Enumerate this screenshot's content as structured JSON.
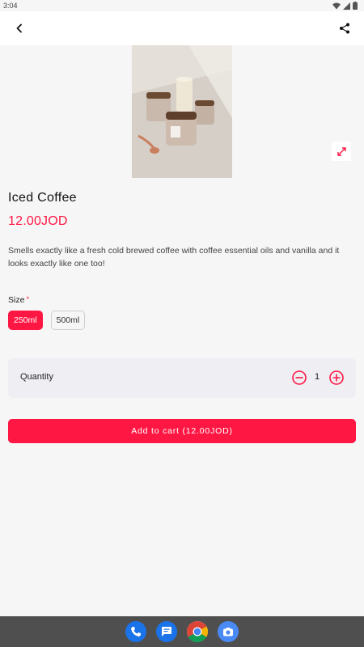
{
  "status_bar": {
    "time": "3:04",
    "icons": [
      "wifi-icon",
      "signal-icon",
      "battery-icon"
    ]
  },
  "app_bar": {
    "back_icon": "back-arrow-icon",
    "share_icon": "share-icon"
  },
  "product": {
    "image_icon": "product-photo",
    "expand_icon": "expand-icon",
    "title": "Iced Coffee",
    "price": "12.00JOD",
    "description": "Smells exactly like a fresh cold brewed coffee with coffee essential oils and vanilla and it looks exactly like one too!"
  },
  "size": {
    "label": "Size",
    "required_marker": "*",
    "options": [
      {
        "label": "250ml",
        "selected": true
      },
      {
        "label": "500ml",
        "selected": false
      }
    ]
  },
  "quantity": {
    "label": "Quantity",
    "value": "1",
    "minus_icon": "minus-circle-icon",
    "plus_icon": "plus-circle-icon"
  },
  "cart_button": {
    "label": "Add to cart (12.00JOD)"
  },
  "colors": {
    "accent": "#ff1744",
    "background": "#f6f6f6",
    "card": "#efeef3",
    "nav_bar": "#4f4f4f"
  },
  "dock": {
    "apps": [
      "phone-icon",
      "messages-icon",
      "chrome-icon",
      "camera-icon"
    ]
  }
}
